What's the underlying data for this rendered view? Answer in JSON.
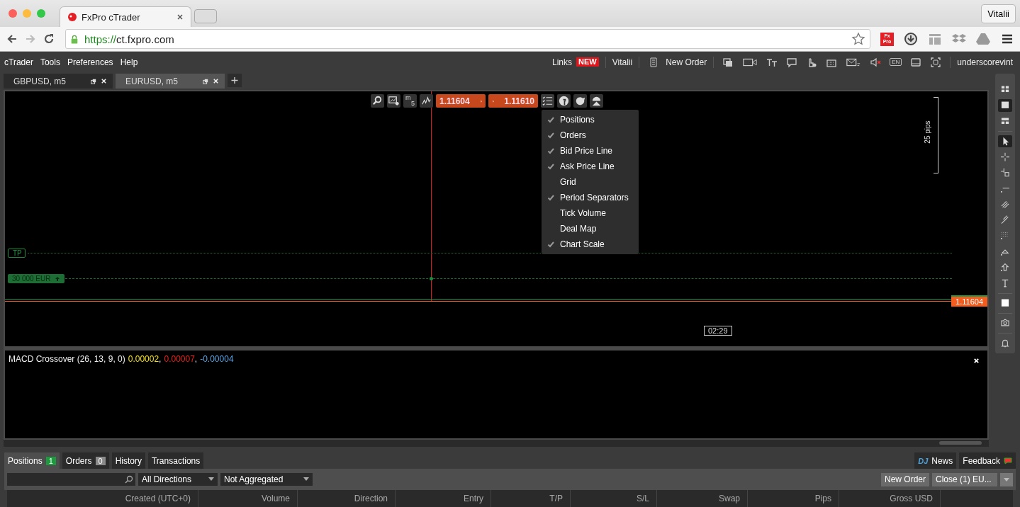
{
  "browser": {
    "tab_title": "FxPro cTrader",
    "profile": "Vitalii",
    "url_scheme": "https://",
    "url_host": "ct.fxpro.com",
    "extension_logo": [
      "Fx",
      "Pro"
    ]
  },
  "menu": [
    "cTrader",
    "Tools",
    "Preferences",
    "Help"
  ],
  "header": {
    "links": "Links",
    "links_badge": "NEW",
    "user": "Vitalii",
    "new_order": "New Order",
    "language": "EN",
    "account": "underscorevint"
  },
  "chart_tabs": [
    {
      "label": "GBPUSD, m5",
      "selected": false
    },
    {
      "label": "EURUSD, m5",
      "selected": true
    }
  ],
  "chart": {
    "timeframe_unit": "m",
    "timeframe_value": "5",
    "bid": "1.11604",
    "ask": "1.11610",
    "options": [
      {
        "label": "Positions",
        "checked": true
      },
      {
        "label": "Orders",
        "checked": true
      },
      {
        "label": "Bid Price Line",
        "checked": true
      },
      {
        "label": "Ask Price Line",
        "checked": true
      },
      {
        "label": "Grid",
        "checked": false
      },
      {
        "label": "Period Separators",
        "checked": true
      },
      {
        "label": "Tick Volume",
        "checked": false
      },
      {
        "label": "Deal Map",
        "checked": false
      },
      {
        "label": "Chart Scale",
        "checked": true
      }
    ],
    "pips": "25 pips",
    "tp_label": "TP",
    "position_label": "30 000 EUR",
    "price_label": "1.11604",
    "time_label": "02:29"
  },
  "indicator": {
    "name": "MACD Crossover (26, 13, 9, 0)",
    "separator": ",",
    "values": [
      {
        "text": "0.00002",
        "color": "#f5e11a"
      },
      {
        "text": "0.00007",
        "color": "#e8231d"
      },
      {
        "text": "-0.00004",
        "color": "#5aa6e6"
      }
    ]
  },
  "tools": [
    {
      "kind": "tiles",
      "selected": false
    },
    {
      "kind": "single",
      "selected": true
    },
    {
      "kind": "rows",
      "selected": false
    },
    {
      "kind": "pointer",
      "selected": true
    },
    {
      "kind": "crosshair",
      "selected": false
    },
    {
      "kind": "cross-box",
      "selected": false
    },
    {
      "kind": "hline",
      "selected": false
    },
    {
      "kind": "fib",
      "selected": false
    },
    {
      "kind": "fork",
      "selected": false
    },
    {
      "kind": "dots",
      "selected": false
    },
    {
      "kind": "triangle",
      "selected": false
    },
    {
      "kind": "arrow",
      "selected": false
    },
    {
      "kind": "text",
      "selected": false
    },
    {
      "kind": "square",
      "selected": false
    },
    {
      "kind": "camera",
      "selected": false
    },
    {
      "kind": "bell",
      "selected": false
    }
  ],
  "positions_panel": {
    "tabs": [
      {
        "label": "Positions",
        "count": "1",
        "color": "#1e9a3e",
        "selected": true
      },
      {
        "label": "Orders",
        "count": "0",
        "color": "#8a8a8a",
        "selected": false
      },
      {
        "label": "History",
        "selected": false
      },
      {
        "label": "Transactions",
        "selected": false
      }
    ],
    "news": {
      "logo": "DJ",
      "label": "News"
    },
    "feedback": "Feedback",
    "filters": [
      "All Directions",
      "Not Aggregated"
    ],
    "new_order": "New Order",
    "close": "Close (1) EU...",
    "columns": [
      "Created  (UTC+0)",
      "Volume",
      "Direction",
      "Entry",
      "T/P",
      "S/L",
      "Swap",
      "Pips",
      "Gross USD"
    ]
  }
}
